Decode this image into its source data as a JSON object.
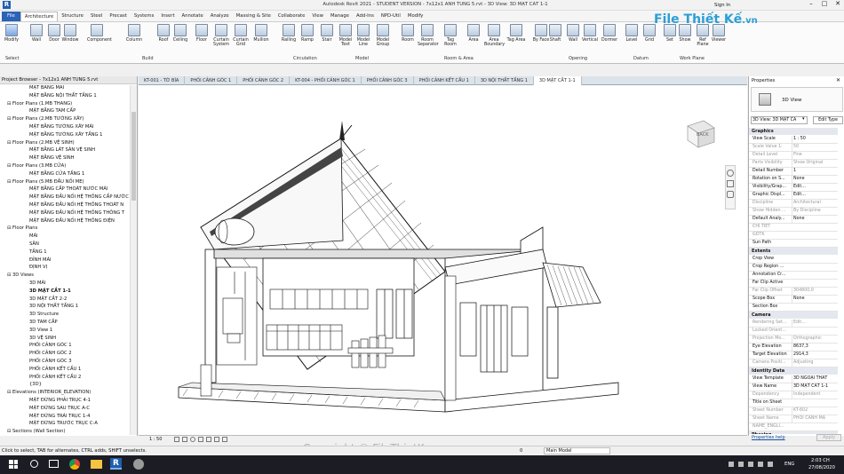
{
  "title_bar": {
    "title": "Autodesk Revit 2021 - STUDENT VERSION - 7x12x1 ANH TUNG 5.rvt - 3D View: 3D MẶT CẮT 1-1",
    "sign_in": "Sign In"
  },
  "ribbon_tabs": [
    "File",
    "Architecture",
    "Structure",
    "Steel",
    "Precast",
    "Systems",
    "Insert",
    "Annotate",
    "Analyze",
    "Massing & Site",
    "Collaborate",
    "View",
    "Manage",
    "Add-Ins",
    "NPD-Util",
    "Modify"
  ],
  "ribbon": {
    "buttons": [
      "Modify",
      "Wall",
      "Door",
      "Window",
      "Component",
      "Column",
      "Roof",
      "Ceiling",
      "Floor",
      "Curtain System",
      "Curtain Grid",
      "Mullion",
      "Railing",
      "Ramp",
      "Stair",
      "Model Text",
      "Model Line",
      "Model Group",
      "Room",
      "Room Separator",
      "Tag Room",
      "Area",
      "Area Boundary",
      "Tag Area",
      "By Face",
      "Shaft",
      "Wall",
      "Vertical",
      "Dormer",
      "Level",
      "Grid",
      "Set",
      "Show",
      "Ref Plane",
      "Viewer"
    ],
    "groups": [
      "Select",
      "Build",
      "Circulation",
      "Model",
      "Room & Area",
      "Opening",
      "Datum",
      "Work Plane"
    ]
  },
  "project_browser": {
    "title": "Project Browser - 7x12x1 ANH TUNG 5.rvt",
    "items": [
      {
        "label": "MẶT BẰNG MÁI",
        "indent": 2
      },
      {
        "label": "MẶT BẰNG NỘI THẤT TẦNG 1",
        "indent": 2
      },
      {
        "label": "Floor Plans (1.MB THANG)",
        "indent": 1
      },
      {
        "label": "MẶT BẰNG TAM CẤP",
        "indent": 2
      },
      {
        "label": "Floor Plans (2.MB TƯỜNG XÂY)",
        "indent": 1
      },
      {
        "label": "MẶT BẰNG TƯỜNG XÂY MÁI",
        "indent": 2
      },
      {
        "label": "MẶT BẰNG TƯỜNG XÂY TẦNG 1",
        "indent": 2
      },
      {
        "label": "Floor Plans (2.MB VỆ SINH)",
        "indent": 1
      },
      {
        "label": "MẶT BẰNG LÁT SÀN VỆ SINH",
        "indent": 2
      },
      {
        "label": "MẶT BẰNG VỆ SINH",
        "indent": 2
      },
      {
        "label": "Floor Plans (3.MB CỬA)",
        "indent": 1
      },
      {
        "label": "MẶT BẰNG CỬA TẦNG 1",
        "indent": 2
      },
      {
        "label": "Floor Plans (5.MB ĐẦU NỐI ME)",
        "indent": 1
      },
      {
        "label": "MẶT BẰNG CẤP THOÁT NƯỚC MÁI",
        "indent": 2
      },
      {
        "label": "MẶT BẰNG ĐẦU NỐI HỆ THỐNG CẤP NƯỚC",
        "indent": 2
      },
      {
        "label": "MẶT BẰNG ĐẦU NỐI HỆ THỐNG THOÁT N",
        "indent": 2
      },
      {
        "label": "MẶT BẰNG ĐẦU NỐI HỆ THỐNG THÔNG T",
        "indent": 2
      },
      {
        "label": "MẶT BẰNG ĐẦU NỐI HỆ THỐNG ĐIỆN",
        "indent": 2
      },
      {
        "label": "Floor Plans",
        "indent": 1
      },
      {
        "label": "MÁI",
        "indent": 2
      },
      {
        "label": "SÂN",
        "indent": 2
      },
      {
        "label": "TẦNG 1",
        "indent": 2
      },
      {
        "label": "ĐỈNH MÁI",
        "indent": 2
      },
      {
        "label": "ĐỊNH VỊ",
        "indent": 2
      },
      {
        "label": "3D Views",
        "indent": 1
      },
      {
        "label": "3D MÁI",
        "indent": 2
      },
      {
        "label": "3D MẶT CẮT 1-1",
        "indent": 2,
        "bold": true
      },
      {
        "label": "3D MẶT CẮT 2-2",
        "indent": 2
      },
      {
        "label": "3D NỘI THẤT TẦNG 1",
        "indent": 2
      },
      {
        "label": "3D Structure",
        "indent": 2
      },
      {
        "label": "3D TAM CẤP",
        "indent": 2
      },
      {
        "label": "3D View 1",
        "indent": 2
      },
      {
        "label": "3D VỆ SINH",
        "indent": 2
      },
      {
        "label": "PHỐI CẢNH GÓC 1",
        "indent": 2
      },
      {
        "label": "PHỐI CẢNH GÓC 2",
        "indent": 2
      },
      {
        "label": "PHỐI CẢNH GÓC 3",
        "indent": 2
      },
      {
        "label": "PHỐI CẢNH KẾT CẤU 1",
        "indent": 2
      },
      {
        "label": "PHỐI CẢNH KẾT CẤU 2",
        "indent": 2
      },
      {
        "label": "{3D}",
        "indent": 2
      },
      {
        "label": "Elevations (INTERIOR_ELEVATION)",
        "indent": 1
      },
      {
        "label": "MẶT ĐỨNG PHẢI TRỤC 4-1",
        "indent": 2
      },
      {
        "label": "MẶT ĐỨNG SAU TRỤC A-C",
        "indent": 2
      },
      {
        "label": "MẶT ĐỨNG TRÁI TRỤC 1-4",
        "indent": 2
      },
      {
        "label": "MẶT ĐỨNG TRƯỚC TRỤC C-A",
        "indent": 2
      },
      {
        "label": "Sections (Wall Section)",
        "indent": 1
      }
    ]
  },
  "view_tabs": [
    {
      "label": "KT-001 - TỜ BÌA",
      "active": false
    },
    {
      "label": "PHỐI CẢNH GÓC 1",
      "active": false
    },
    {
      "label": "PHỐI CẢNH GÓC 2",
      "active": false
    },
    {
      "label": "KT-004 - PHỐI CẢNH GÓC 1",
      "active": false
    },
    {
      "label": "PHỐI CẢNH GÓC 3",
      "active": false
    },
    {
      "label": "PHỐI CẢNH KẾT CẤU 1",
      "active": false
    },
    {
      "label": "3D NỘI THẤT TẦNG 1",
      "active": false
    },
    {
      "label": "3D MẶT CẮT 1-1",
      "active": true
    }
  ],
  "viewcube_label": "BACK",
  "view_control": {
    "scale": "1 : 50"
  },
  "properties": {
    "title": "Properties",
    "type_name": "3D View",
    "selector": "3D View: 3D MẶT CẮ",
    "edit_type": "Edit Type",
    "sections": [
      {
        "name": "Graphics",
        "rows": [
          {
            "k": "View Scale",
            "v": "1 : 50"
          },
          {
            "k": "Scale Value    1:",
            "v": "50",
            "grey": true
          },
          {
            "k": "Detail Level",
            "v": "Fine",
            "grey": true
          },
          {
            "k": "Parts Visibility",
            "v": "Show Original",
            "grey": true
          },
          {
            "k": "Detail Number",
            "v": "1"
          },
          {
            "k": "Rotation on S...",
            "v": "None"
          },
          {
            "k": "Visibility/Grap...",
            "v": "Edit..."
          },
          {
            "k": "Graphic Displ...",
            "v": "Edit..."
          },
          {
            "k": "Discipline",
            "v": "Architectural",
            "grey": true
          },
          {
            "k": "Show Hidden ...",
            "v": "By Discipline",
            "grey": true
          },
          {
            "k": "Default Analy...",
            "v": "None"
          },
          {
            "k": "CHI TIẾT",
            "v": "",
            "grey": true
          },
          {
            "k": "GDTK",
            "v": "",
            "grey": true
          },
          {
            "k": "Sun Path",
            "v": ""
          }
        ]
      },
      {
        "name": "Extents",
        "rows": [
          {
            "k": "Crop View",
            "v": ""
          },
          {
            "k": "Crop Region ...",
            "v": ""
          },
          {
            "k": "Annotation Cr...",
            "v": ""
          },
          {
            "k": "Far Clip Active",
            "v": ""
          },
          {
            "k": "Far Clip Offset",
            "v": "304800,0",
            "grey": true
          },
          {
            "k": "Scope Box",
            "v": "None"
          },
          {
            "k": "Section Box",
            "v": ""
          }
        ]
      },
      {
        "name": "Camera",
        "rows": [
          {
            "k": "Rendering Set...",
            "v": "Edit...",
            "grey": true
          },
          {
            "k": "Locked Orient...",
            "v": "",
            "grey": true
          },
          {
            "k": "Projection Mo...",
            "v": "Orthographic",
            "grey": true
          },
          {
            "k": "Eye Elevation",
            "v": "8637,3"
          },
          {
            "k": "Target Elevation",
            "v": "2914,3"
          },
          {
            "k": "Camera Positi...",
            "v": "Adjusting",
            "grey": true
          }
        ]
      },
      {
        "name": "Identity Data",
        "rows": [
          {
            "k": "View Template",
            "v": "3D NGOẠI THẤT"
          },
          {
            "k": "View Name",
            "v": "3D MẶT CẮT 1-1"
          },
          {
            "k": "Dependency",
            "v": "Independent",
            "grey": true
          },
          {
            "k": "Title on Sheet",
            "v": ""
          },
          {
            "k": "Sheet Number",
            "v": "KT-602",
            "grey": true
          },
          {
            "k": "Sheet Name",
            "v": "PHỐI CẢNH MẶ",
            "grey": true
          },
          {
            "k": "NAME_ENGLI...",
            "v": "",
            "grey": true
          }
        ]
      },
      {
        "name": "Phasing",
        "rows": []
      }
    ],
    "help_link": "Properties help",
    "apply": "Apply"
  },
  "status_bar": {
    "text": "Click to select, TAB for alternates, CTRL adds, SHIFT unselects.",
    "model": "Main Model",
    "zero": "0"
  },
  "watermark": {
    "brand": "File Thiết Kế",
    "domain": ".vn",
    "copyright": "Copyright © FileThietKe.vn"
  },
  "taskbar": {
    "lang": "ENG",
    "time": "2:03 CH",
    "date": "27/08/2020"
  }
}
